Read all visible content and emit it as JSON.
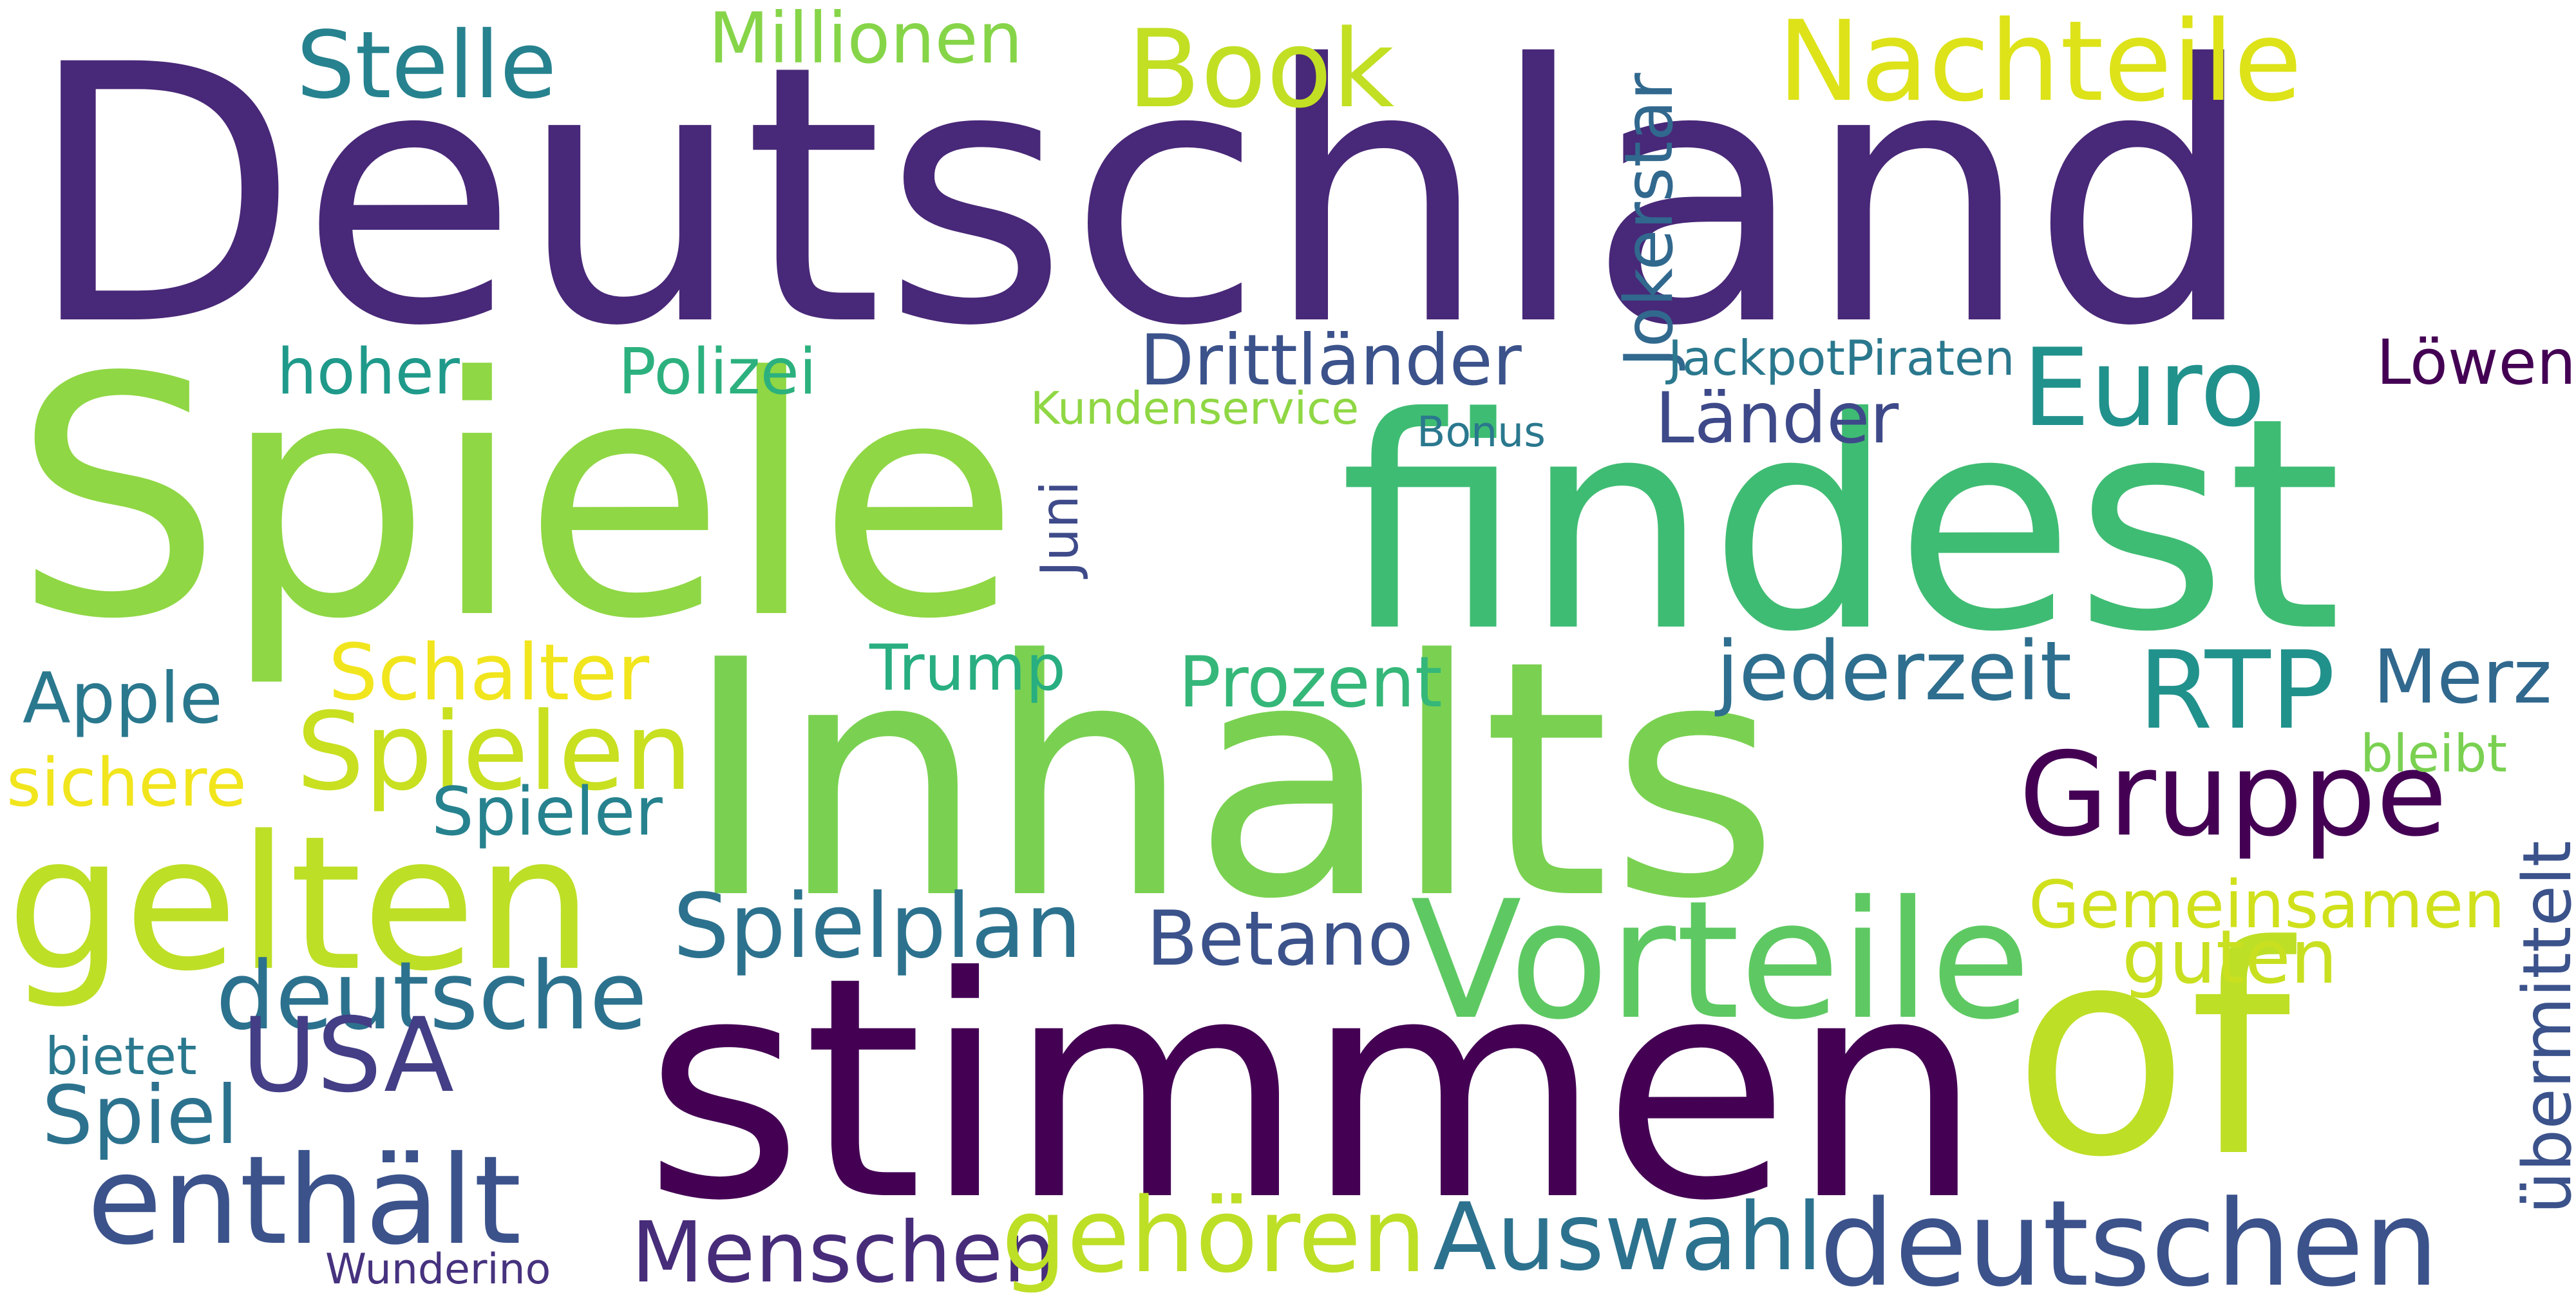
{
  "words": [
    {
      "text": "Deutschland",
      "color": "#482878",
      "rotated": false
    },
    {
      "text": "Spiele",
      "color": "#8fd744",
      "rotated": false
    },
    {
      "text": "findest",
      "color": "#3fbc73",
      "rotated": false
    },
    {
      "text": "Inhalts",
      "color": "#7ad151",
      "rotated": false
    },
    {
      "text": "stimmen",
      "color": "#440154",
      "rotated": false
    },
    {
      "text": "of",
      "color": "#bddf26",
      "rotated": false
    },
    {
      "text": "gelten",
      "color": "#bddf26",
      "rotated": false
    },
    {
      "text": "Nachteile",
      "color": "#dde318",
      "rotated": false
    },
    {
      "text": "Book",
      "color": "#c2df23",
      "rotated": false
    },
    {
      "text": "Stelle",
      "color": "#26828e",
      "rotated": false
    },
    {
      "text": "Millionen",
      "color": "#86d549",
      "rotated": false
    },
    {
      "text": "Jokerstar",
      "color": "#31688e",
      "rotated": true
    },
    {
      "text": "Euro",
      "color": "#21918c",
      "rotated": false
    },
    {
      "text": "Löwen",
      "color": "#440154",
      "rotated": false
    },
    {
      "text": "JackpotPiraten",
      "color": "#2a788e",
      "rotated": false
    },
    {
      "text": "Drittländer",
      "color": "#3b528b",
      "rotated": false
    },
    {
      "text": "hoher",
      "color": "#1f9a8a",
      "rotated": false
    },
    {
      "text": "Polizei",
      "color": "#2cb17e",
      "rotated": false
    },
    {
      "text": "Kundenservice",
      "color": "#8fd744",
      "rotated": false
    },
    {
      "text": "Länder",
      "color": "#3e4989",
      "rotated": false
    },
    {
      "text": "Bonus",
      "color": "#2a788e",
      "rotated": false
    },
    {
      "text": "Juni",
      "color": "#3e4a89",
      "rotated": true
    },
    {
      "text": "Apple",
      "color": "#2a788e",
      "rotated": false
    },
    {
      "text": "Schalter",
      "color": "#f1e51d",
      "rotated": false
    },
    {
      "text": "Trump",
      "color": "#28ae80",
      "rotated": false
    },
    {
      "text": "Prozent",
      "color": "#35b779",
      "rotated": false
    },
    {
      "text": "jederzeit",
      "color": "#2e6e8e",
      "rotated": false
    },
    {
      "text": "RTP",
      "color": "#21918c",
      "rotated": false
    },
    {
      "text": "Merz",
      "color": "#31688e",
      "rotated": false
    },
    {
      "text": "Spielen",
      "color": "#c8e020",
      "rotated": false
    },
    {
      "text": "sichere",
      "color": "#f1e51d",
      "rotated": false
    },
    {
      "text": "Spieler",
      "color": "#26828e",
      "rotated": false
    },
    {
      "text": "Gruppe",
      "color": "#440154",
      "rotated": false
    },
    {
      "text": "bleibt",
      "color": "#7ad151",
      "rotated": false
    },
    {
      "text": "übermittelt",
      "color": "#3b528b",
      "rotated": true
    },
    {
      "text": "Spielplan",
      "color": "#2c728e",
      "rotated": false
    },
    {
      "text": "Betano",
      "color": "#3b528b",
      "rotated": false
    },
    {
      "text": "Gemeinsamen",
      "color": "#d0e11c",
      "rotated": false
    },
    {
      "text": "Vorteile",
      "color": "#5ec962",
      "rotated": false
    },
    {
      "text": "guten",
      "color": "#c8e020",
      "rotated": false
    },
    {
      "text": "deutsche",
      "color": "#2c728e",
      "rotated": false
    },
    {
      "text": "USA",
      "color": "#433e85",
      "rotated": false
    },
    {
      "text": "bietet",
      "color": "#2a788e",
      "rotated": false
    },
    {
      "text": "Spiel",
      "color": "#2c728e",
      "rotated": false
    },
    {
      "text": "enthält",
      "color": "#3b528b",
      "rotated": false
    },
    {
      "text": "Menschen",
      "color": "#472c7a",
      "rotated": false
    },
    {
      "text": "gehören",
      "color": "#bddf26",
      "rotated": false
    },
    {
      "text": "Auswahl",
      "color": "#2c728e",
      "rotated": false
    },
    {
      "text": "deutschen",
      "color": "#3b528b",
      "rotated": false
    },
    {
      "text": "Wunderino",
      "color": "#46327e",
      "rotated": false
    }
  ]
}
